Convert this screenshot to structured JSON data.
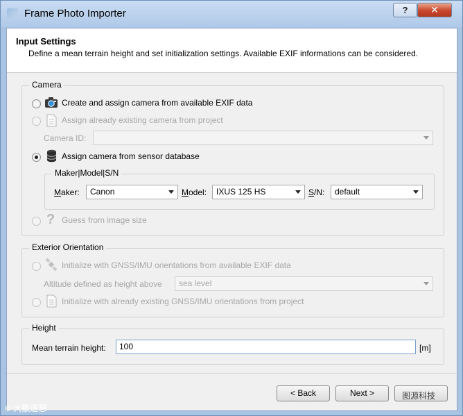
{
  "window": {
    "title": "Frame Photo Importer",
    "help_label": "?",
    "close_label": "✕"
  },
  "header": {
    "title": "Input Settings",
    "description": "Define a mean terrain height and set initialization settings. Available EXIF informations can be considered."
  },
  "camera": {
    "group_title": "Camera",
    "opt_exif": "Create and assign camera from available EXIF data",
    "opt_existing": "Assign already existing camera from project",
    "camera_id_label": "Camera ID:",
    "camera_id_value": "",
    "opt_sensor_db": "Assign camera from sensor database",
    "sub_group_title": "Maker|Model|S/N",
    "maker_label": "Maker:",
    "maker_value": "Canon",
    "model_label": "Model:",
    "model_value": "IXUS 125 HS",
    "sn_label": "S/N:",
    "sn_value": "default",
    "opt_guess": "Guess from image size"
  },
  "exterior": {
    "group_title": "Exterior Orientation",
    "opt_gnss_exif": "Initialize with GNSS/IMU orientations from available EXIF data",
    "altitude_label": "Altitude defined as height above",
    "altitude_value": "sea level",
    "opt_gnss_project": "Initialize with already existing GNSS/IMU orientations from project"
  },
  "height": {
    "group_title": "Height",
    "mean_label": "Mean terrain height:",
    "mean_value": "100",
    "unit": "[m]"
  },
  "footer": {
    "back_label": "< Back",
    "next_label": "Next >",
    "watermark_right": "图源科技",
    "watermark_left": "© 大散遥想"
  }
}
